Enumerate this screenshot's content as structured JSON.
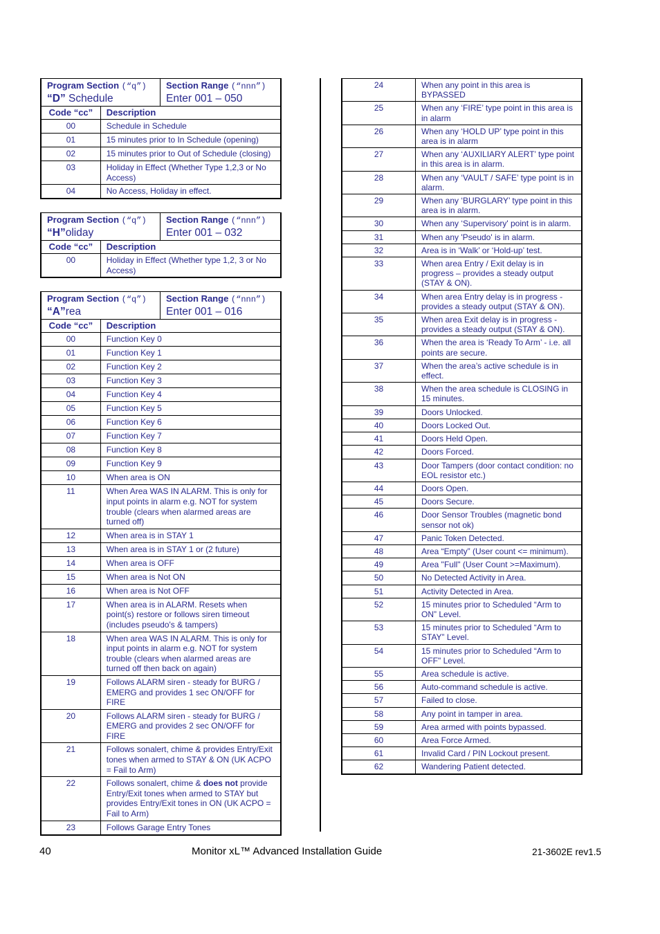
{
  "left_column": {
    "tables": [
      {
        "program_section_label": "Program Section",
        "program_section_var": "(“q”)",
        "section_letter": "“D”",
        "section_name": " Schedule",
        "section_range_label": "Section Range",
        "section_range_var": "(“nnn”)",
        "section_range_value": "Enter 001 – 050",
        "col_code": "Code “cc”",
        "col_desc": "Description",
        "rows": [
          {
            "code": "00",
            "desc": "Schedule in Schedule"
          },
          {
            "code": "01",
            "desc": "15 minutes prior to In Schedule (opening)"
          },
          {
            "code": "02",
            "desc": "15 minutes prior to Out of Schedule (closing)"
          },
          {
            "code": "03",
            "desc": "Holiday in Effect (Whether Type 1,2,3 or No Access)"
          },
          {
            "code": "04",
            "desc": "No Access, Holiday in effect."
          }
        ]
      },
      {
        "program_section_label": "Program Section",
        "program_section_var": "(“q”)",
        "section_letter": "“H”",
        "section_name": "oliday",
        "section_range_label": "Section Range",
        "section_range_var": "(“nnn”)",
        "section_range_value": "Enter 001 – 032",
        "col_code": "Code “cc”",
        "col_desc": "Description",
        "rows": [
          {
            "code": "00",
            "desc": "Holiday in Effect (Whether type 1,2, 3 or No Access)"
          }
        ]
      },
      {
        "program_section_label": "Program Section",
        "program_section_var": "(“q”)",
        "section_letter": "“A”",
        "section_name": "rea",
        "section_range_label": "Section Range",
        "section_range_var": "(“nnn”)",
        "section_range_value": "Enter 001 – 016",
        "col_code": "Code “cc”",
        "col_desc": "Description",
        "rows": [
          {
            "code": "00",
            "desc": "Function Key 0"
          },
          {
            "code": "01",
            "desc": "Function Key 1"
          },
          {
            "code": "02",
            "desc": "Function Key 2"
          },
          {
            "code": "03",
            "desc": "Function Key 3"
          },
          {
            "code": "04",
            "desc": "Function Key 4"
          },
          {
            "code": "05",
            "desc": "Function Key 5"
          },
          {
            "code": "06",
            "desc": "Function Key 6"
          },
          {
            "code": "07",
            "desc": "Function Key 7"
          },
          {
            "code": "08",
            "desc": "Function Key 8"
          },
          {
            "code": "09",
            "desc": "Function Key 9"
          },
          {
            "code": "10",
            "desc": "When area is ON"
          },
          {
            "code": "11",
            "desc": "When Area WAS IN ALARM. This is only for input points in alarm e.g. NOT for system trouble (clears when alarmed areas are turned off)"
          },
          {
            "code": "12",
            "desc": "When area is in STAY 1"
          },
          {
            "code": "13",
            "desc": "When area is in STAY 1 or (2 future)"
          },
          {
            "code": "14",
            "desc": "When area is OFF"
          },
          {
            "code": "15",
            "desc": "When area is Not ON"
          },
          {
            "code": "16",
            "desc": "When area is Not OFF"
          },
          {
            "code": "17",
            "desc": "When area is in ALARM.  Resets when point(s) restore or follows siren timeout (includes pseudo's & tampers)"
          },
          {
            "code": "18",
            "desc": "When area WAS IN ALARM. This is only for input points in alarm e.g. NOT for system trouble (clears when alarmed areas are turned off then back on again)"
          },
          {
            "code": "19",
            "desc": "Follows ALARM siren - steady for BURG / EMERG and provides 1 sec ON/OFF for  FIRE"
          },
          {
            "code": "20",
            "desc": "Follows ALARM siren - steady for BURG / EMERG and provides 2 sec ON/OFF for FIRE"
          },
          {
            "code": "21",
            "desc": "Follows sonalert, chime & provides Entry/Exit tones when armed to STAY & ON (UK ACPO = Fail to Arm)"
          },
          {
            "code": "22",
            "desc_pre": "Follows sonalert, chime & ",
            "desc_bold": "does not",
            "desc_post": " provide Entry/Exit tones when armed to STAY but provides Entry/Exit tones in ON (UK ACPO = Fail to Arm)"
          },
          {
            "code": "23",
            "desc": "Follows Garage Entry Tones"
          }
        ]
      }
    ]
  },
  "right_column": {
    "rows": [
      {
        "code": "24",
        "desc": "When any point in this area is BYPASSED"
      },
      {
        "code": "25",
        "desc": "When any ‘FIRE’ type point in this area is in alarm"
      },
      {
        "code": "26",
        "desc": "When any ‘HOLD UP’ type point in this area is in alarm"
      },
      {
        "code": "27",
        "desc": "When any ‘AUXILIARY ALERT’ type point in this area is in alarm."
      },
      {
        "code": "28",
        "desc": "When any ‘VAULT / SAFE’ type point is in alarm."
      },
      {
        "code": "29",
        "desc": "When any ‘BURGLARY’ type point in this area is in alarm."
      },
      {
        "code": "30",
        "desc": "When any ‘Supervisory' point is in alarm."
      },
      {
        "code": "31",
        "desc": "When any 'Pseudo' is in alarm."
      },
      {
        "code": "32",
        "desc": "Area is in ‘Walk’ or ‘Hold-up’ test."
      },
      {
        "code": "33",
        "desc": "When area Entry / Exit delay is in progress – provides a steady output (STAY & ON)."
      },
      {
        "code": "34",
        "desc": "When area Entry delay is in progress - provides a steady output (STAY & ON)."
      },
      {
        "code": "35",
        "desc": "When area Exit delay is in progress - provides a steady output (STAY & ON)."
      },
      {
        "code": "36",
        "desc": "When the area is ‘Ready To Arm’ - i.e. all points are secure."
      },
      {
        "code": "37",
        "desc": "When the area’s active schedule is in effect."
      },
      {
        "code": "38",
        "desc": "When the area schedule is CLOSING in 15 minutes."
      },
      {
        "code": "39",
        "desc": "Doors Unlocked."
      },
      {
        "code": "40",
        "desc": "Doors Locked Out."
      },
      {
        "code": "41",
        "desc": "Doors Held Open."
      },
      {
        "code": "42",
        "desc": "Doors Forced."
      },
      {
        "code": "43",
        "desc": "Door Tampers (door contact condition: no EOL resistor etc.)"
      },
      {
        "code": "44",
        "desc": "Doors Open."
      },
      {
        "code": "45",
        "desc": "Doors Secure."
      },
      {
        "code": "46",
        "desc": "Door Sensor Troubles (magnetic bond sensor not ok)"
      },
      {
        "code": "47",
        "desc": "Panic Token Detected."
      },
      {
        "code": "48",
        "desc": "Area “Empty” (User count <= minimum)."
      },
      {
        "code": "49",
        "desc": "Area \"Full\" (User Count >=Maximum)."
      },
      {
        "code": "50",
        "desc": "No Detected Activity in Area."
      },
      {
        "code": "51",
        "desc": "Activity Detected in Area."
      },
      {
        "code": "52",
        "desc": "15 minutes prior to Scheduled “Arm to ON” Level."
      },
      {
        "code": "53",
        "desc": "15 minutes prior to Scheduled “Arm to STAY” Level."
      },
      {
        "code": "54",
        "desc": "15 minutes prior to Scheduled “Arm to OFF\" Level."
      },
      {
        "code": "55",
        "desc": "Area schedule is active."
      },
      {
        "code": "56",
        "desc": "Auto-command schedule is active."
      },
      {
        "code": "57",
        "desc": "Failed to close."
      },
      {
        "code": "58",
        "desc": "Any point in tamper in area."
      },
      {
        "code": "59",
        "desc": "Area armed with points bypassed."
      },
      {
        "code": "60",
        "desc": "Area Force Armed."
      },
      {
        "code": "61",
        "desc": "Invalid Card / PIN Lockout present."
      },
      {
        "code": "62",
        "desc": "Wandering Patient detected."
      }
    ]
  },
  "footer": {
    "page_number": "40",
    "title": "Monitor xL™ Advanced Installation Guide",
    "doc_id": "21-3602E rev1.5"
  }
}
